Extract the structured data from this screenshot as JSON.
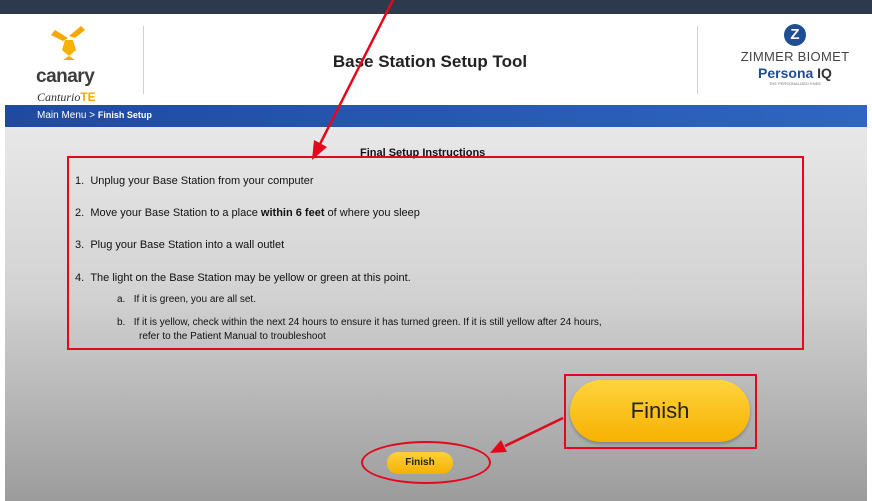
{
  "header": {
    "app_title": "Base Station Setup Tool",
    "left_brand": "canary",
    "left_sub_brand": "Canturio",
    "left_sub_brand_suffix": "TE",
    "right_brand": "ZIMMER BIOMET",
    "right_product": "Persona",
    "right_product_suffix": "IQ",
    "right_product_tagline": "THE PERSONALIZED KNEE"
  },
  "breadcrumb": {
    "root": "Main Menu",
    "separator": ">",
    "current": "Finish Setup"
  },
  "instructions": {
    "title": "Final Setup Instructions",
    "steps": [
      {
        "number": "1.",
        "text": "Unplug your Base Station from your computer"
      },
      {
        "number": "2.",
        "text_before": "Move your Base Station to a place",
        "bold": "within 6 feet",
        "text_after": "of where you sleep"
      },
      {
        "number": "3.",
        "text": "Plug your Base Station into a wall outlet"
      },
      {
        "number": "4.",
        "text": "The light on the Base Station may be yellow or green at this point."
      }
    ],
    "substeps": [
      {
        "letter": "a.",
        "text": "If it is green, you are all set."
      },
      {
        "letter": "b.",
        "text_line1": "If it is yellow, check within the next 24 hours to ensure it has turned green. If it is still yellow after 24 hours,",
        "text_line2": "refer to the Patient Manual to troubleshoot"
      }
    ]
  },
  "finish_button": {
    "label": "Finish"
  },
  "callout": {
    "label": "Finish"
  },
  "colors": {
    "annotation_red": "#e3081c",
    "button_yellow": "#f6b000",
    "breadcrumb_blue": "#1f4aa0"
  }
}
